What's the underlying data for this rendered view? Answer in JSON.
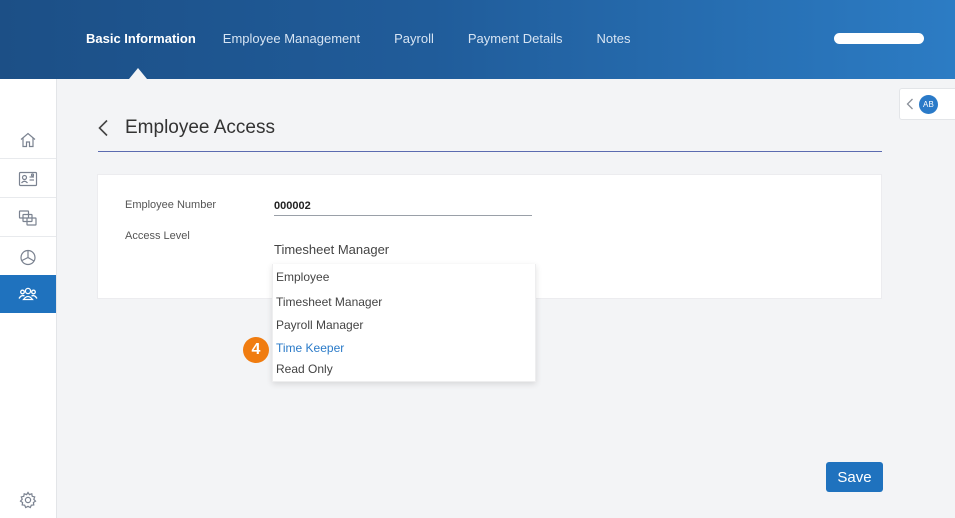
{
  "topbar": {
    "tabs": [
      {
        "label": "Basic Information",
        "active": true
      },
      {
        "label": "Employee Management",
        "active": false
      },
      {
        "label": "Payroll",
        "active": false
      },
      {
        "label": "Payment Details",
        "active": false
      },
      {
        "label": "Notes",
        "active": false
      }
    ],
    "gradient_start": "#1c4f86",
    "gradient_end": "#2c7cc4"
  },
  "sidebar": {
    "items": [
      {
        "icon": "home-icon"
      },
      {
        "icon": "employee-card-icon"
      },
      {
        "icon": "documents-icon"
      },
      {
        "icon": "pie-chart-icon"
      },
      {
        "icon": "users-icon",
        "active": true
      }
    ],
    "footer_icon": "gear-icon",
    "accent": "#1f72be"
  },
  "user_panel": {
    "avatar_initials": "AB"
  },
  "page": {
    "title": "Employee Access"
  },
  "form": {
    "employee_number_label": "Employee Number",
    "employee_number_value": "000002",
    "access_level_label": "Access Level",
    "access_level_value": "Timesheet Manager",
    "access_level_options": [
      "Employee",
      "Timesheet Manager",
      "Payroll Manager",
      "Time Keeper",
      "Read Only"
    ],
    "highlighted_option": "Time Keeper"
  },
  "step_badge": "4",
  "save_label": "Save"
}
